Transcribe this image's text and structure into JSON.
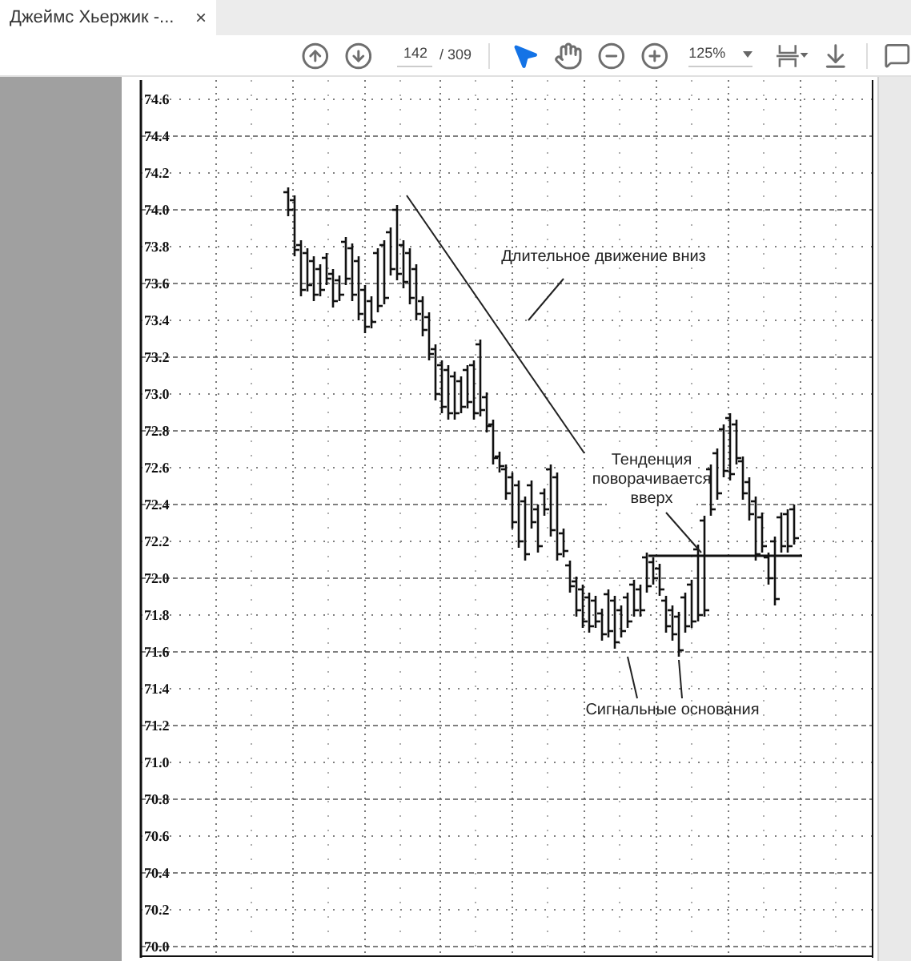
{
  "tab": {
    "title": "Джеймс Хьержик -...",
    "close": "×",
    "selected": true
  },
  "toolbar": {
    "page": "142",
    "total": "/ 309",
    "zoom": "125%",
    "tools": [
      {
        "kind": "select",
        "selected": true
      },
      {
        "kind": "hand",
        "selected": false
      }
    ]
  },
  "document": {
    "y_axis_labels": [
      "74.6",
      "74.4",
      "74.2",
      "74.0",
      "73.8",
      "73.6",
      "73.4",
      "73.2",
      "73.0",
      "72.8",
      "72.6",
      "72.4",
      "72.2",
      "72.0",
      "71.8",
      "71.6",
      "71.4",
      "71.2",
      "71.0",
      "70.8",
      "70.6",
      "70.4",
      "70.2",
      "70.0"
    ],
    "annotations": [
      {
        "kind": "downtrend",
        "text": "Длительное движение вниз"
      },
      {
        "kind": "reversal",
        "text": "Тенденция поворачивается вверх"
      },
      {
        "kind": "bases",
        "text": "Сигнальные основания"
      }
    ]
  }
}
